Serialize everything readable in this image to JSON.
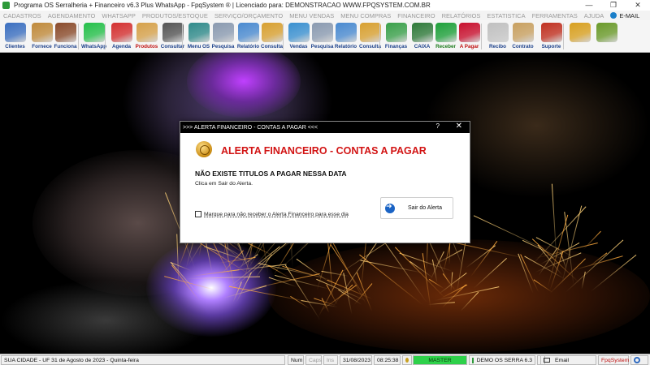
{
  "window": {
    "title": "Programa OS Serralheria + Financeiro v6.3 Plus WhatsApp - FpqSystem ® | Licenciado para: DEMONSTRACAO WWW.FPQSYSTEM.COM.BR",
    "controls": [
      "—",
      "❐",
      "✕"
    ]
  },
  "menu": {
    "items": [
      "CADASTROS",
      "AGENDAMENTO",
      "WHATSAPP",
      "PRODUTOS/ESTOQUE",
      "SERVIÇO/ORÇAMENTO",
      "MENU VENDAS",
      "MENU COMPRAS",
      "FINANCEIRO",
      "RELATÓRIOS",
      "ESTATISTICA",
      "FERRAMENTAS",
      "AJUDA"
    ],
    "email": "E-MAIL"
  },
  "toolbar": {
    "buttons": [
      {
        "label": "Clientes",
        "icon": "clients-icon",
        "color": "#3b6fc0"
      },
      {
        "label": "Fornece",
        "icon": "suppliers-icon",
        "color": "#c08a3b"
      },
      {
        "label": "Funciona",
        "icon": "employees-icon",
        "color": "#8a4b2b"
      },
      {
        "label": "WhatsApp",
        "icon": "whatsapp-icon",
        "color": "#25c04a"
      },
      {
        "label": "Agenda",
        "icon": "calendar-icon",
        "color": "#d43030"
      },
      {
        "label": "Produtos",
        "icon": "boxes-icon",
        "color": "#d6a14a"
      },
      {
        "label": "Consultar",
        "icon": "barcode-icon",
        "color": "#555555"
      },
      {
        "label": "Menu OS",
        "icon": "wrench-icon",
        "color": "#2f8a8a"
      },
      {
        "label": "Pesquisa",
        "icon": "search-doc-icon",
        "color": "#8a9ab0"
      },
      {
        "label": "Relatório",
        "icon": "report-icon",
        "color": "#4a8ad0"
      },
      {
        "label": "Consulta",
        "icon": "folder-icon",
        "color": "#d8a030"
      },
      {
        "label": "Vendas",
        "icon": "monitor-icon",
        "color": "#3a90d0"
      },
      {
        "label": "Pesquisa",
        "icon": "search-doc-icon",
        "color": "#8a9ab0"
      },
      {
        "label": "Relatório",
        "icon": "report-icon",
        "color": "#4a8ad0"
      },
      {
        "label": "Consulta",
        "icon": "folder-icon",
        "color": "#d8a030"
      },
      {
        "label": "Finanças",
        "icon": "finance-icon",
        "color": "#3aa04a"
      },
      {
        "label": "CAIXA",
        "icon": "cash-register-icon",
        "color": "#2f7a3a"
      },
      {
        "label": "Receber",
        "icon": "dollar-green-icon",
        "color": "#1ea03a"
      },
      {
        "label": "A Pagar",
        "icon": "dollar-red-icon",
        "color": "#c8102e"
      },
      {
        "label": "Recibo",
        "icon": "receipt-icon",
        "color": "#c0c0c0"
      },
      {
        "label": "Contrato",
        "icon": "contract-icon",
        "color": "#c8a060"
      },
      {
        "label": "Suporte",
        "icon": "support-icon",
        "color": "#c03020"
      },
      {
        "label": "",
        "icon": "coin-icon",
        "color": "#d8a020"
      },
      {
        "label": "",
        "icon": "exit-icon",
        "color": "#6a9a2a"
      }
    ]
  },
  "dialog": {
    "title": ">>> ALERTA FINANCEIRO - CONTAS A PAGAR <<<",
    "help": "?",
    "close": "✕",
    "heading": "ALERTA FINANCEIRO - CONTAS A PAGAR",
    "message": "NÃO EXISTE TITULOS A PAGAR NESSA DATA",
    "hint": "Clica em Sair do Alerta.",
    "checkbox_label": "Marque para não receber o Alerta Financeiro para esse dia",
    "checkbox_checked": false,
    "exit_button": "Sair do Alerta"
  },
  "statusbar": {
    "city": "SUA CIDADE - UF 31 de Agosto de 2023 - Quinta-feira",
    "num": "Num",
    "caps": "Caps",
    "ins": "Ins",
    "date": "31/08/2023",
    "time": "08:25:38",
    "mode": "MASTER",
    "version": "DEMO OS SERRA 6.3",
    "email": "Email",
    "brand": "FpqSystem"
  }
}
